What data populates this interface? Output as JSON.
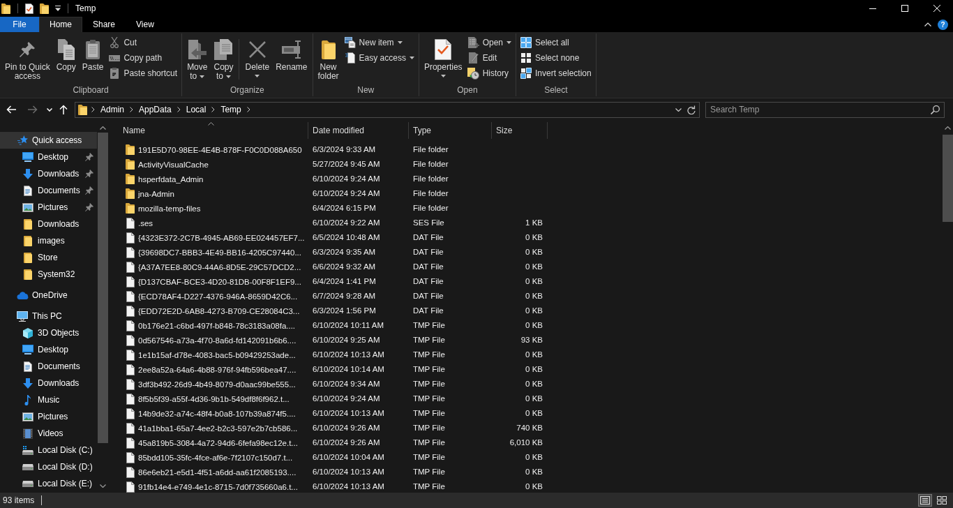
{
  "window": {
    "title": "Temp"
  },
  "ribbon": {
    "file_tab": "File",
    "tabs": [
      {
        "label": "Home",
        "selected": true
      },
      {
        "label": "Share",
        "selected": false
      },
      {
        "label": "View",
        "selected": false
      }
    ],
    "help_button": "?",
    "groups": [
      {
        "label": "Clipboard",
        "sections": [
          {
            "kind": "large",
            "buttons": [
              {
                "label": "Pin to Quick\naccess",
                "kind": "plain"
              },
              {
                "label": "Copy",
                "kind": "plain"
              },
              {
                "label": "Paste",
                "kind": "plain"
              }
            ]
          },
          {
            "kind": "small",
            "buttons": [
              {
                "label": "Cut",
                "kind": "plain"
              },
              {
                "label": "Copy path",
                "kind": "plain"
              },
              {
                "label": "Paste shortcut",
                "kind": "plain"
              }
            ]
          }
        ]
      },
      {
        "label": "Organize",
        "sections": [
          {
            "kind": "large",
            "buttons": [
              {
                "label": "Move\nto",
                "kind": "dropdown"
              },
              {
                "label": "Copy\nto",
                "kind": "dropdown"
              }
            ]
          },
          {
            "kind": "divider"
          },
          {
            "kind": "large",
            "buttons": [
              {
                "label": "Delete",
                "kind": "split"
              },
              {
                "label": "Rename",
                "kind": "plain"
              }
            ]
          }
        ]
      },
      {
        "label": "New",
        "sections": [
          {
            "kind": "large",
            "buttons": [
              {
                "label": "New\nfolder",
                "kind": "plain"
              }
            ]
          },
          {
            "kind": "small",
            "buttons": [
              {
                "label": "New item",
                "kind": "dropdown"
              },
              {
                "label": "Easy access",
                "kind": "dropdown"
              }
            ]
          }
        ]
      },
      {
        "label": "Open",
        "sections": [
          {
            "kind": "large",
            "buttons": [
              {
                "label": "Properties",
                "kind": "split"
              }
            ]
          },
          {
            "kind": "small",
            "buttons": [
              {
                "label": "Open",
                "kind": "dropdown"
              },
              {
                "label": "Edit",
                "kind": "plain"
              },
              {
                "label": "History",
                "kind": "plain"
              }
            ]
          }
        ]
      },
      {
        "label": "Select",
        "sections": [
          {
            "kind": "small",
            "buttons": [
              {
                "label": "Select all",
                "kind": "plain"
              },
              {
                "label": "Select none",
                "kind": "plain"
              },
              {
                "label": "Invert selection",
                "kind": "plain"
              }
            ]
          }
        ]
      }
    ]
  },
  "nav_buttons": [
    {
      "kind": "back",
      "disabled": false
    },
    {
      "kind": "forward",
      "disabled": true
    },
    {
      "kind": "recent",
      "disabled": false
    },
    {
      "kind": "up",
      "disabled": false
    }
  ],
  "address_bar": {
    "crumbs": [
      "Admin",
      "AppData",
      "Local",
      "Temp"
    ]
  },
  "search": {
    "placeholder": "Search Temp"
  },
  "sidebar": {
    "items": [
      {
        "label": "Quick access",
        "kind": "quick_access",
        "selected": true,
        "children": [
          {
            "label": "Desktop",
            "kind": "desktop",
            "pinned": true,
            "selected": false
          },
          {
            "label": "Downloads",
            "kind": "downloads",
            "pinned": true,
            "selected": false
          },
          {
            "label": "Documents",
            "kind": "documents",
            "pinned": true,
            "selected": false
          },
          {
            "label": "Pictures",
            "kind": "pictures",
            "pinned": true,
            "selected": false
          },
          {
            "label": "Downloads",
            "kind": "folder",
            "pinned": false,
            "selected": false
          },
          {
            "label": "images",
            "kind": "folder",
            "pinned": false,
            "selected": false
          },
          {
            "label": "Store",
            "kind": "folder",
            "pinned": false,
            "selected": false
          },
          {
            "label": "System32",
            "kind": "folder",
            "pinned": false,
            "selected": false
          }
        ]
      },
      {
        "label": "OneDrive",
        "kind": "onedrive",
        "selected": false
      },
      {
        "label": "This PC",
        "kind": "pc",
        "selected": false,
        "children": [
          {
            "label": "3D Objects",
            "kind": "objects3d",
            "selected": false
          },
          {
            "label": "Desktop",
            "kind": "desktop",
            "selected": false
          },
          {
            "label": "Documents",
            "kind": "documents",
            "selected": false
          },
          {
            "label": "Downloads",
            "kind": "downloads",
            "selected": false
          },
          {
            "label": "Music",
            "kind": "music",
            "selected": false
          },
          {
            "label": "Pictures",
            "kind": "pictures",
            "selected": false
          },
          {
            "label": "Videos",
            "kind": "videos",
            "selected": false
          },
          {
            "label": "Local Disk (C:)",
            "kind": "system_drive",
            "selected": false
          },
          {
            "label": "Local Disk (D:)",
            "kind": "drive",
            "selected": false
          },
          {
            "label": "Local Disk (E:)",
            "kind": "drive",
            "selected": false
          }
        ]
      }
    ]
  },
  "file_list": {
    "columns": [
      {
        "label": "Name",
        "sorted": true
      },
      {
        "label": "Date modified",
        "sorted": false
      },
      {
        "label": "Type",
        "sorted": false
      },
      {
        "label": "Size",
        "sorted": false
      }
    ],
    "rows": [
      {
        "kind": "folder",
        "name": "191E5D70-98EE-4E4B-878F-F0C0D088A650",
        "date": "6/3/2024 9:33 AM",
        "type": "File folder"
      },
      {
        "kind": "folder",
        "name": "ActivityVisualCache",
        "date": "5/27/2024 9:45 AM",
        "type": "File folder"
      },
      {
        "kind": "folder",
        "name": "hsperfdata_Admin",
        "date": "6/10/2024 9:24 AM",
        "type": "File folder"
      },
      {
        "kind": "folder",
        "name": "jna-Admin",
        "date": "6/10/2024 9:24 AM",
        "type": "File folder"
      },
      {
        "kind": "folder",
        "name": "mozilla-temp-files",
        "date": "6/4/2024 6:15 PM",
        "type": "File folder"
      },
      {
        "kind": "file",
        "name": ".ses",
        "date": "6/10/2024 9:22 AM",
        "type": "SES File",
        "size": "1 KB"
      },
      {
        "kind": "file",
        "name": "{4323E372-2C7B-4945-AB69-EE024457EF7...",
        "date": "6/5/2024 10:48 AM",
        "type": "DAT File",
        "size": "0 KB"
      },
      {
        "kind": "file",
        "name": "{39698DC7-BBB3-4E49-BB16-4205C97440...",
        "date": "6/3/2024 9:35 AM",
        "type": "DAT File",
        "size": "0 KB"
      },
      {
        "kind": "file",
        "name": "{A37A7EE8-80C9-44A6-8D5E-29C57DCD2...",
        "date": "6/6/2024 9:32 AM",
        "type": "DAT File",
        "size": "0 KB"
      },
      {
        "kind": "file",
        "name": "{D137CBAF-BCE3-4D20-81DB-00F8F1EF9...",
        "date": "6/4/2024 1:41 PM",
        "type": "DAT File",
        "size": "0 KB"
      },
      {
        "kind": "file",
        "name": "{ECD78AF4-D227-4376-946A-8659D42C6...",
        "date": "6/7/2024 9:28 AM",
        "type": "DAT File",
        "size": "0 KB"
      },
      {
        "kind": "file",
        "name": "{EDD72E2D-6AB8-4273-B709-CE28084C3...",
        "date": "6/3/2024 1:56 PM",
        "type": "DAT File",
        "size": "0 KB"
      },
      {
        "kind": "file",
        "name": "0b176e21-c6bd-497f-b848-78c3183a08fa....",
        "date": "6/10/2024 10:11 AM",
        "type": "TMP File",
        "size": "0 KB"
      },
      {
        "kind": "file",
        "name": "0d567546-a73a-4f70-8a6d-fd142091b6b6....",
        "date": "6/10/2024 9:25 AM",
        "type": "TMP File",
        "size": "93 KB"
      },
      {
        "kind": "file",
        "name": "1e1b15af-d78e-4083-bac5-b09429253ade...",
        "date": "6/10/2024 10:13 AM",
        "type": "TMP File",
        "size": "0 KB"
      },
      {
        "kind": "file",
        "name": "2ee8a52a-64a6-4b88-976f-94fb596bea47....",
        "date": "6/10/2024 10:14 AM",
        "type": "TMP File",
        "size": "0 KB"
      },
      {
        "kind": "file",
        "name": "3df3b492-26d9-4b49-8079-d0aac99be555...",
        "date": "6/10/2024 9:34 AM",
        "type": "TMP File",
        "size": "0 KB"
      },
      {
        "kind": "file",
        "name": "8f5b5f39-a55f-4d36-9b1b-549df8f6f962.t...",
        "date": "6/10/2024 9:24 AM",
        "type": "TMP File",
        "size": "0 KB"
      },
      {
        "kind": "file",
        "name": "14b9de32-a74c-48f4-b0a8-107b39a874f5....",
        "date": "6/10/2024 10:13 AM",
        "type": "TMP File",
        "size": "0 KB"
      },
      {
        "kind": "file",
        "name": "41a1bba1-65a7-4ee2-b2c3-597e2b7cb586...",
        "date": "6/10/2024 9:26 AM",
        "type": "TMP File",
        "size": "740 KB"
      },
      {
        "kind": "file",
        "name": "45a819b5-3084-4a72-94d6-6fefa98ec12e.t...",
        "date": "6/10/2024 9:26 AM",
        "type": "TMP File",
        "size": "6,010 KB"
      },
      {
        "kind": "file",
        "name": "85bdd105-35fc-4fce-af6e-7f2107c150d7.t...",
        "date": "6/10/2024 10:04 AM",
        "type": "TMP File",
        "size": "0 KB"
      },
      {
        "kind": "file",
        "name": "86e6eb21-e5d1-4f51-a6dd-aa61f2085193....",
        "date": "6/10/2024 10:13 AM",
        "type": "TMP File",
        "size": "0 KB"
      },
      {
        "kind": "file",
        "name": "91fb14e4-e749-4e1c-8715-7d0f735660a6.t...",
        "date": "6/10/2024 10:13 AM",
        "type": "TMP File",
        "size": "0 KB"
      }
    ]
  },
  "status_bar": {
    "item_count": "93 items",
    "view_buttons": [
      {
        "kind": "details",
        "selected": true
      },
      {
        "kind": "large_icons",
        "selected": false
      }
    ]
  }
}
